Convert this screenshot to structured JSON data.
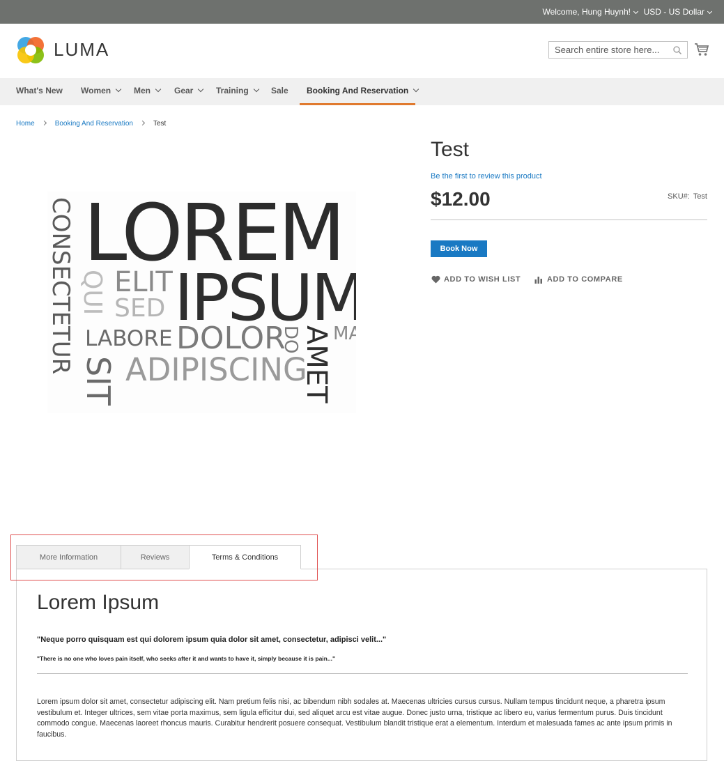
{
  "top_bar": {
    "welcome": "Welcome, Hung Huynh!",
    "currency": "USD - US Dollar"
  },
  "header": {
    "logo_text": "LUMA",
    "search_placeholder": "Search entire store here...",
    "icons": {
      "search": "search-icon",
      "cart": "cart-icon",
      "logo": "luma-logo-icon"
    }
  },
  "nav": {
    "items": [
      {
        "label": "What's New"
      },
      {
        "label": "Women"
      },
      {
        "label": "Men"
      },
      {
        "label": "Gear"
      },
      {
        "label": "Training"
      },
      {
        "label": "Sale"
      },
      {
        "label": "Booking And Reservation"
      }
    ],
    "active_color": "#e07a2f"
  },
  "breadcrumb": {
    "home": "Home",
    "category": "Booking And Reservation",
    "current": "Test"
  },
  "product": {
    "image_words": [
      "LOREM",
      "IPSUM",
      "CONSECTETUR",
      "QUI",
      "ELIT",
      "SED",
      "LABORE",
      "DOLOR",
      "DO",
      "AMET",
      "MA",
      "SIT",
      "ADIPISCING"
    ],
    "title": "Test",
    "review_link": "Be the first to review this product",
    "price": "$12.00",
    "sku_label": "SKU#:",
    "sku_value": "Test",
    "book_button": "Book Now",
    "wishlist": "ADD TO WISH LIST",
    "compare": "ADD TO COMPARE",
    "accent": "#1979c3"
  },
  "tabs": {
    "items": [
      {
        "label": "More Information"
      },
      {
        "label": "Reviews"
      },
      {
        "label": "Terms & Conditions"
      }
    ],
    "active_index": 2
  },
  "panel": {
    "heading": "Lorem Ipsum",
    "quote1": "\"Neque porro quisquam est qui dolorem ipsum quia dolor sit amet, consectetur, adipisci velit...\"",
    "quote2": "\"There is no one who loves pain itself, who seeks after it and wants to have it, simply because it is pain...\"",
    "body": "Lorem ipsum dolor sit amet, consectetur adipiscing elit. Nam pretium felis nisi, ac bibendum nibh sodales at. Maecenas ultricies cursus cursus. Nullam tempus tincidunt neque, a pharetra ipsum vestibulum et. Integer ultrices, sem vitae porta maximus, sem ligula efficitur dui, sed aliquet arcu est vitae augue. Donec justo urna, tristique ac libero eu, varius fermentum purus. Duis tincidunt commodo congue. Maecenas laoreet rhoncus mauris. Curabitur hendrerit posuere consequat. Vestibulum blandit tristique erat a elementum. Interdum et malesuada fames ac ante ipsum primis in faucibus."
  }
}
